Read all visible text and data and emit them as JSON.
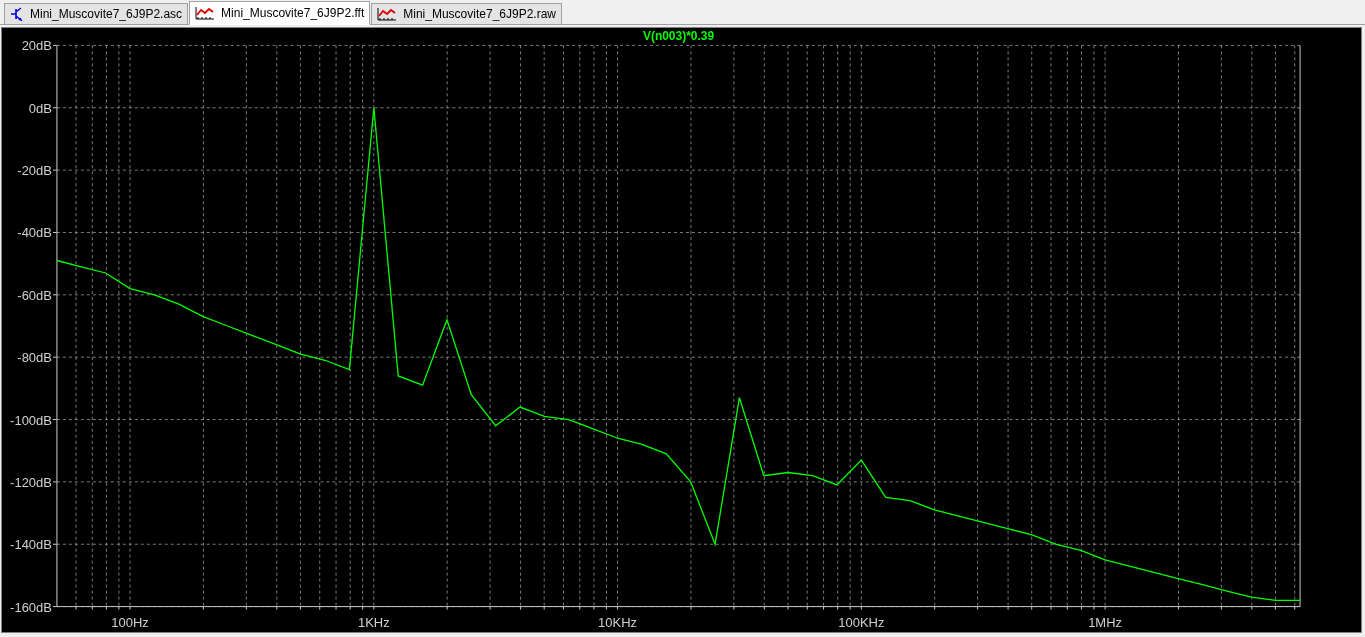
{
  "tabs": [
    {
      "label": "Mini_Muscovite7_6J9P2.asc",
      "kind": "schematic",
      "selected": false
    },
    {
      "label": "Mini_Muscovite7_6J9P2.fft",
      "kind": "waveform",
      "selected": true
    },
    {
      "label": "Mini_Muscovite7_6J9P2.raw",
      "kind": "waveform",
      "selected": false
    }
  ],
  "plot": {
    "chart_data": {
      "type": "line",
      "grid": true,
      "ylim": [
        -160,
        20
      ],
      "yticks": [
        {
          "value": 20,
          "label": "20dB"
        },
        {
          "value": 0,
          "label": "0dB"
        },
        {
          "value": -20,
          "label": "-20dB"
        },
        {
          "value": -40,
          "label": "-40dB"
        },
        {
          "value": -60,
          "label": "-60dB"
        },
        {
          "value": -80,
          "label": "-80dB"
        },
        {
          "value": -100,
          "label": "-100dB"
        },
        {
          "value": -120,
          "label": "-120dB"
        },
        {
          "value": -140,
          "label": "-140dB"
        },
        {
          "value": -160,
          "label": "-160dB"
        }
      ],
      "categories": [
        null,
        null,
        null,
        "100Hz",
        null,
        null,
        null,
        null,
        null,
        null,
        null,
        null,
        null,
        "1KHz",
        null,
        null,
        null,
        null,
        null,
        null,
        null,
        null,
        null,
        "10KHz",
        null,
        null,
        null,
        null,
        null,
        null,
        null,
        null,
        null,
        "100KHz",
        null,
        null,
        null,
        null,
        null,
        null,
        null,
        null,
        null,
        "1MHz",
        null,
        null,
        null,
        null,
        null,
        null,
        null,
        null
      ],
      "series": [
        {
          "name": "V(n003)*0.39",
          "color": "#00ff00",
          "values": [
            -49,
            -51,
            -53,
            -58,
            -60,
            -63,
            -67,
            -70,
            -73,
            -76,
            -79,
            -81,
            -84,
            0,
            -86,
            -89,
            -68,
            -92,
            -102,
            -96,
            -99,
            -100,
            -103,
            -106,
            -108,
            -111,
            -120,
            -140,
            -93,
            -118,
            -117,
            -118,
            -121,
            -113,
            -125,
            -126,
            -129,
            -131,
            -133,
            -135,
            -137,
            -140,
            -142,
            -145,
            -147,
            -149,
            -151,
            -153,
            -155,
            -157,
            -158,
            -158
          ]
        }
      ]
    }
  }
}
